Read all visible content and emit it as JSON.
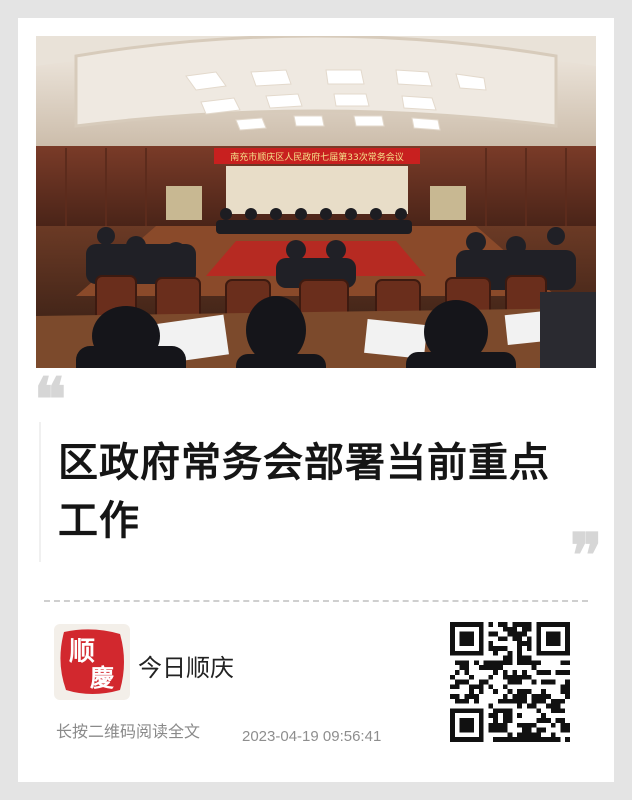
{
  "photo": {
    "banner_text": "南充市顺庆区人民政府七届第33次常务会议",
    "alt": "区政府常务会议现场"
  },
  "article": {
    "quote_open": "❝",
    "quote_close": "❞",
    "headline": "区政府常务会部署当前重点工作"
  },
  "account": {
    "logo_text_top": "顺",
    "logo_text_bottom": "慶",
    "name": "今日顺庆"
  },
  "footer": {
    "hint": "长按二维码阅读全文",
    "timestamp": "2023-04-19 09:56:41"
  },
  "colors": {
    "background": "#e4e4e4",
    "card": "#ffffff",
    "logo_red": "#d2282e",
    "banner_red": "#c8201f"
  }
}
